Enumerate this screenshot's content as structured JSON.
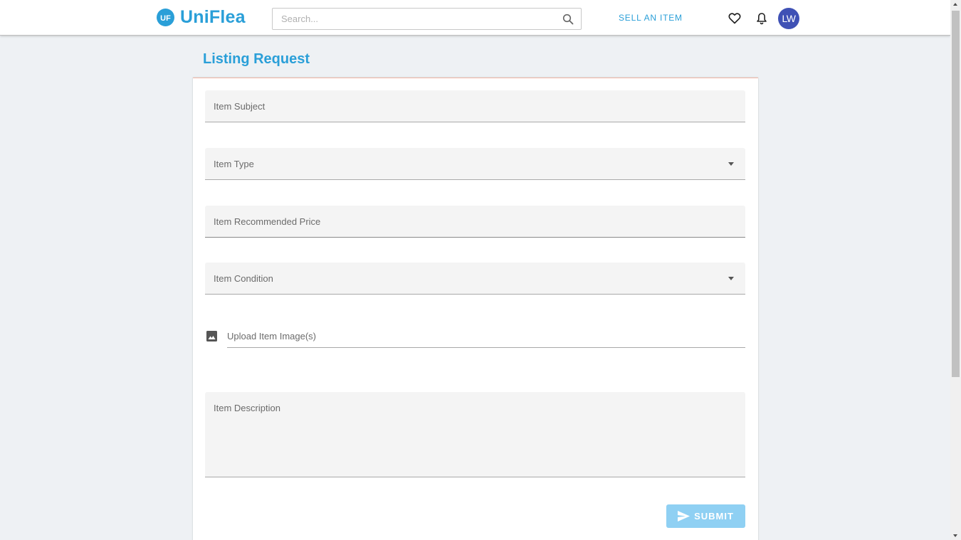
{
  "header": {
    "brand_name": "UniFlea",
    "logo_initials": "UF",
    "search_placeholder": "Search...",
    "sell_link_label": "SELL AN ITEM",
    "user_initials": "LW",
    "icons": {
      "logo": "uniflea-logo-icon",
      "search": "search-icon",
      "favorites": "heart-icon",
      "notifications": "bell-icon"
    }
  },
  "page": {
    "title": "Listing Request"
  },
  "form": {
    "subject_label": "Item Subject",
    "type_label": "Item Type",
    "price_label": "Item Recommended Price",
    "condition_label": "Item Condition",
    "upload_label": "Upload Item Image(s)",
    "description_label": "Item Description",
    "submit_label": "SUBMIT",
    "icons": {
      "upload": "image-icon",
      "submit": "send-icon",
      "dropdown": "caret-down-icon"
    }
  },
  "colors": {
    "brand": "#2a9fd8",
    "avatar": "#3f51b5",
    "submit_disabled": "#8fd0f3",
    "page_background": "#eef1f4"
  }
}
